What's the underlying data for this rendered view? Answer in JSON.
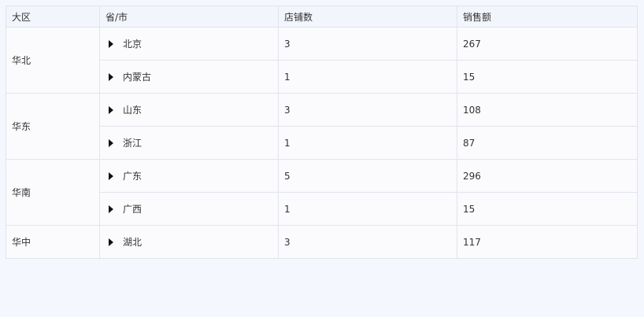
{
  "columns": [
    "大区",
    "省/市",
    "店铺数",
    "销售额"
  ],
  "groups": [
    {
      "region": "华北",
      "rows": [
        {
          "province": "北京",
          "stores": "3",
          "sales": "267"
        },
        {
          "province": "内蒙古",
          "stores": "1",
          "sales": "15"
        }
      ]
    },
    {
      "region": "华东",
      "rows": [
        {
          "province": "山东",
          "stores": "3",
          "sales": "108"
        },
        {
          "province": "浙江",
          "stores": "1",
          "sales": "87"
        }
      ]
    },
    {
      "region": "华南",
      "rows": [
        {
          "province": "广东",
          "stores": "5",
          "sales": "296"
        },
        {
          "province": "广西",
          "stores": "1",
          "sales": "15"
        }
      ]
    },
    {
      "region": "华中",
      "rows": [
        {
          "province": "湖北",
          "stores": "3",
          "sales": "117"
        }
      ]
    }
  ]
}
